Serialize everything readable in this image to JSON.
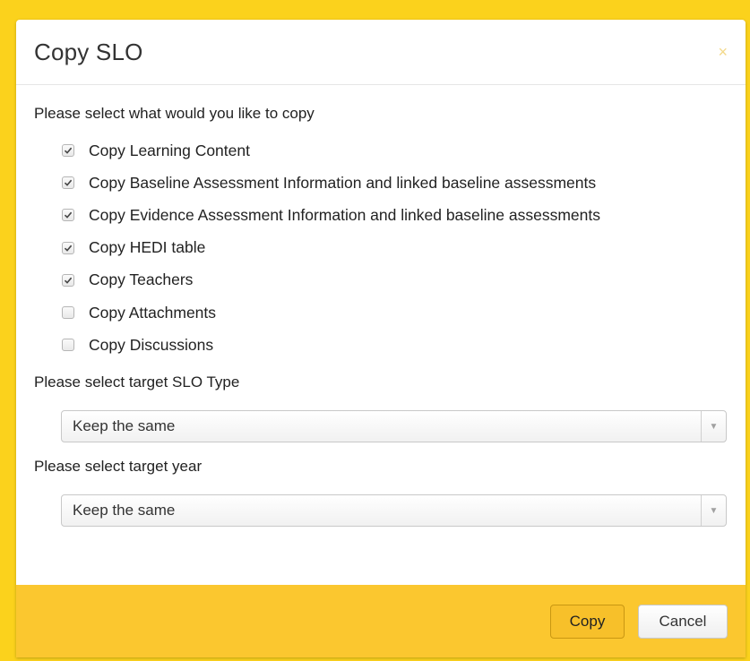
{
  "dialog": {
    "title": "Copy SLO",
    "close_glyph": "×",
    "copy_prompt": "Please select what would you like to copy",
    "options": [
      {
        "label": "Copy Learning Content",
        "checked": true
      },
      {
        "label": "Copy Baseline Assessment Information and linked baseline assessments",
        "checked": true
      },
      {
        "label": "Copy Evidence Assessment Information and linked baseline assessments",
        "checked": true
      },
      {
        "label": "Copy HEDI table",
        "checked": true
      },
      {
        "label": "Copy Teachers",
        "checked": true
      },
      {
        "label": "Copy Attachments",
        "checked": false
      },
      {
        "label": "Copy Discussions",
        "checked": false
      }
    ],
    "slo_type_label": "Please select target SLO Type",
    "slo_type_value": "Keep the same",
    "year_label": "Please select target year",
    "year_value": "Keep the same"
  },
  "footer": {
    "copy_label": "Copy",
    "cancel_label": "Cancel"
  },
  "colors": {
    "frame": "#fbd21c",
    "footer": "#fbc72f",
    "copy_button": "#f7c02a"
  },
  "icons": [
    "close-icon",
    "checkbox-check-icon",
    "dropdown-arrow-icon"
  ]
}
